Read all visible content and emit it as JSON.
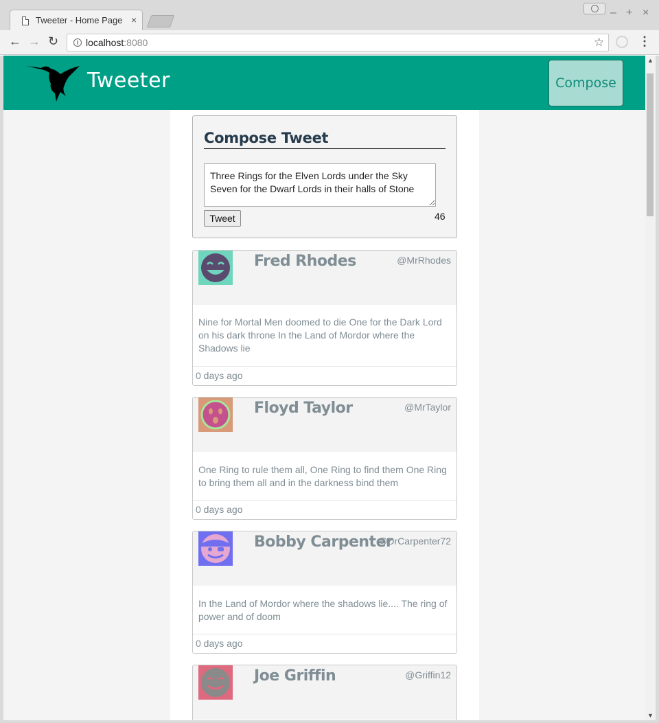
{
  "browser": {
    "tab_title": "Tweeter - Home Page",
    "tab_close": "×",
    "url_host": "localhost",
    "url_port": ":8080",
    "info": "i"
  },
  "navbar": {
    "brand": "Tweeter",
    "compose_label": "Compose",
    "accent_color": "#00a087"
  },
  "compose": {
    "title": "Compose Tweet",
    "text": "Three Rings for the Elven Lords under the Sky\nSeven for the Dwarf Lords in their halls of Stone",
    "tweet_button": "Tweet",
    "counter": "46"
  },
  "tweets": [
    {
      "name": "Fred Rhodes",
      "handle": "@MrRhodes",
      "content": "Nine for Mortal Men doomed to die One for the Dark Lord on his dark throne In the Land of Mordor where the Shadows lie",
      "time": "0 days ago",
      "avatar_bg": "#6fd6bd",
      "avatar_face": "#5a4a6e",
      "avatar_icon": "grinning-face-icon"
    },
    {
      "name": "Floyd Taylor",
      "handle": "@MrTaylor",
      "content": "One Ring to rule them all, One Ring to find them One Ring to bring them all and in the darkness bind them",
      "time": "0 days ago",
      "avatar_bg": "#d89a78",
      "avatar_face": "#c4508d",
      "avatar_icon": "surprised-face-icon"
    },
    {
      "name": "Bobby Carpenter",
      "handle": "@DrCarpenter72",
      "content": "In the Land of Mordor where the shadows lie.... The ring of power and of doom",
      "time": "0 days ago",
      "avatar_bg": "#6f6ff0",
      "avatar_face": "#e6a7d1",
      "avatar_icon": "pirate-face-icon"
    },
    {
      "name": "Joe Griffin",
      "handle": "@Griffin12",
      "content": "",
      "time": "",
      "avatar_bg": "#dd6a7e",
      "avatar_face": "#8a8a8a",
      "avatar_icon": "smirking-face-icon"
    }
  ]
}
